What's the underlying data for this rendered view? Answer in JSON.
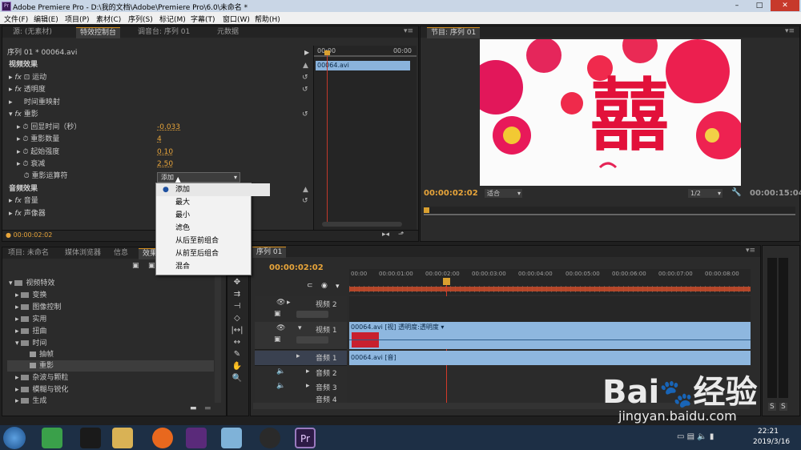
{
  "window": {
    "title": "Adobe Premiere Pro - D:\\我的文档\\Adobe\\Premiere Pro\\6.0\\未命名 *",
    "min": "–",
    "max": "□",
    "close": "✕"
  },
  "menu": [
    "文件(F)",
    "编辑(E)",
    "项目(P)",
    "素材(C)",
    "序列(S)",
    "标记(M)",
    "字幕(T)",
    "窗口(W)",
    "帮助(H)"
  ],
  "effect_controls": {
    "tabs": [
      "源: (无素材)",
      "特效控制台",
      "调音台: 序列 01",
      "元数据"
    ],
    "sequence_label": "序列 01 * 00064.avi",
    "clip_name": "00064.avi",
    "ruler_start": "00:00",
    "ruler_end": "00:00",
    "video_effects_header": "视频效果",
    "audio_effects_header": "音频效果",
    "effects": [
      {
        "name": "运动"
      },
      {
        "name": "透明度"
      },
      {
        "name": "时间重映射"
      },
      {
        "name": "重影"
      }
    ],
    "ghost_params": [
      {
        "label": "回显时间（秒）",
        "value": "-0.033"
      },
      {
        "label": "重影数量",
        "value": "4"
      },
      {
        "label": "起始强度",
        "value": "0.10"
      },
      {
        "label": "衰减",
        "value": "2.50"
      },
      {
        "label": "重影运算符",
        "value": "添加"
      }
    ],
    "audio_effects": [
      {
        "name": "音量"
      },
      {
        "name": "声像器"
      }
    ],
    "timecode": "00:00:02:02"
  },
  "operator_menu": {
    "items": [
      "添加",
      "最大",
      "最小",
      "滤色",
      "从后至前组合",
      "从前至后组合",
      "混合"
    ],
    "selected_index": 0
  },
  "program_monitor": {
    "tab": "节目: 序列 01",
    "current_time": "00:00:02:02",
    "fit": "适合",
    "quality": "1/2",
    "duration": "00:00:15:04",
    "image_glyph": "囍"
  },
  "project_panel": {
    "tabs": [
      "项目: 未命名",
      "媒体浏览器",
      "信息",
      "效果"
    ],
    "tree": [
      {
        "label": "视频特效",
        "indent": 0
      },
      {
        "label": "变换",
        "indent": 1
      },
      {
        "label": "图像控制",
        "indent": 1
      },
      {
        "label": "实用",
        "indent": 1
      },
      {
        "label": "扭曲",
        "indent": 1
      },
      {
        "label": "时间",
        "indent": 1
      },
      {
        "label": "抽帧",
        "indent": 2
      },
      {
        "label": "重影",
        "indent": 2
      },
      {
        "label": "杂波与颗粒",
        "indent": 1
      },
      {
        "label": "模糊与锐化",
        "indent": 1
      },
      {
        "label": "生成",
        "indent": 1
      }
    ]
  },
  "timeline": {
    "tab": "序列 01",
    "timecode": "00:00:02:02",
    "ticks": [
      "00:00",
      "00:00:01:00",
      "00:00:02:00",
      "00:00:03:00",
      "00:00:04:00",
      "00:00:05:00",
      "00:00:06:00",
      "00:00:07:00",
      "00:00:08:00"
    ],
    "video_tracks": [
      "视频 2",
      "视频 1"
    ],
    "audio_tracks": [
      "音频 1",
      "音频 2",
      "音频 3",
      "音频 4"
    ],
    "video_clip_label": "00064.avi [视] 透明度:透明度 ▾",
    "audio_clip_label": "00064.avi [音]"
  },
  "audio_meter": {
    "solo_left": "S",
    "solo_right": "S"
  },
  "taskbar": {
    "time": "22:21",
    "date": "2019/3/16"
  },
  "watermark": {
    "brand": "Bai",
    "brand_suffix": "经验",
    "url": "jingyan.baidu.com"
  }
}
